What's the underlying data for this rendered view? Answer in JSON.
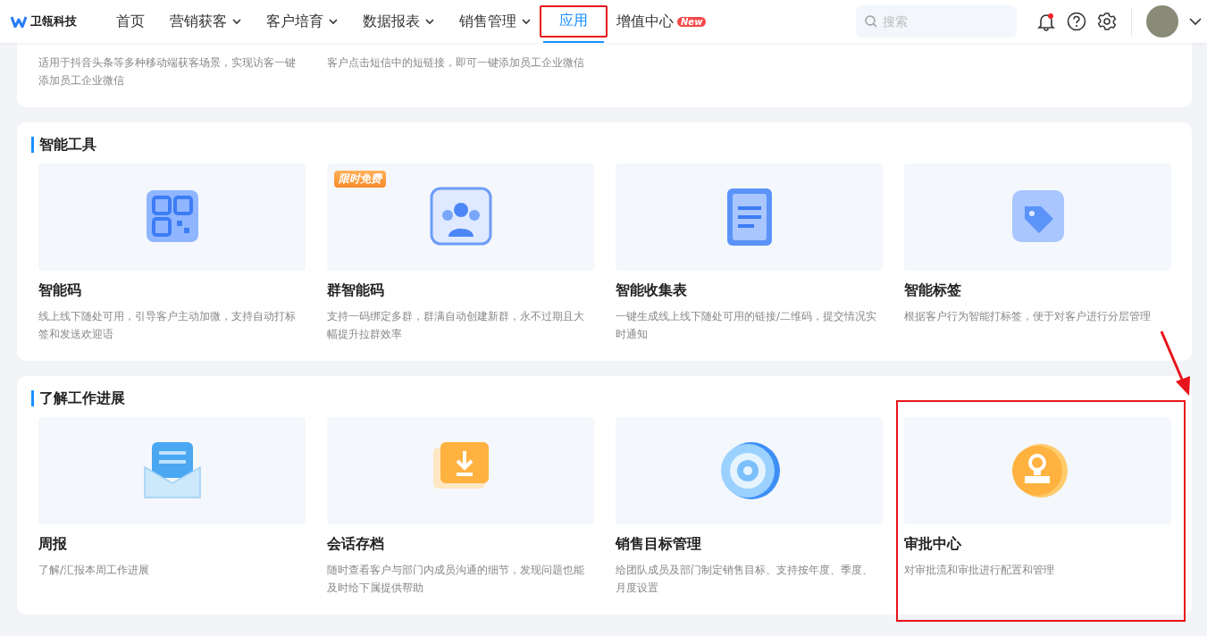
{
  "header": {
    "logo": "卫瓴科技",
    "nav": [
      {
        "label": "首页",
        "dropdown": false,
        "selected": false,
        "highlighted": false
      },
      {
        "label": "营销获客",
        "dropdown": true,
        "selected": false,
        "highlighted": false
      },
      {
        "label": "客户培育",
        "dropdown": true,
        "selected": false,
        "highlighted": false
      },
      {
        "label": "数据报表",
        "dropdown": true,
        "selected": false,
        "highlighted": false
      },
      {
        "label": "销售管理",
        "dropdown": true,
        "selected": false,
        "highlighted": false
      },
      {
        "label": "应用",
        "dropdown": false,
        "selected": true,
        "highlighted": true
      },
      {
        "label": "增值中心",
        "dropdown": false,
        "selected": false,
        "highlighted": false,
        "badge": "New"
      }
    ],
    "search": {
      "placeholder": "搜索"
    },
    "notification_dot": true
  },
  "top_section": {
    "descriptions": [
      "适用于抖音头条等多种移动端获客场景，实现访客一键添加员工企业微信",
      "客户点击短信中的短链接，即可一键添加员工企业微信"
    ]
  },
  "sections": [
    {
      "title": "智能工具",
      "tiles": [
        {
          "kind": "qr",
          "name": "智能码",
          "description": "线上线下随处可用，引导客户主动加微，支持自动打标签和发送欢迎语",
          "highlighted": false
        },
        {
          "kind": "group",
          "name": "群智能码",
          "description": "支持一码绑定多群，群满自动创建新群，永不过期且大幅提升拉群效率",
          "badge": "限时免费",
          "highlighted": false
        },
        {
          "kind": "form",
          "name": "智能收集表",
          "description": "一键生成线上线下随处可用的链接/二维码，提交情况实时通知",
          "highlighted": false
        },
        {
          "kind": "tag",
          "name": "智能标签",
          "description": "根据客户行为智能打标签，便于对客户进行分层管理",
          "highlighted": false
        }
      ]
    },
    {
      "title": "了解工作进展",
      "tiles": [
        {
          "kind": "report",
          "name": "周报",
          "description": "了解/汇报本周工作进展",
          "highlighted": false
        },
        {
          "kind": "chat",
          "name": "会话存档",
          "description": "随时查看客户与部门内成员沟通的细节，发现问题也能及时给下属提供帮助",
          "highlighted": false
        },
        {
          "kind": "target",
          "name": "销售目标管理",
          "description": "给团队成员及部门制定销售目标、支持按年度、季度、月度设置",
          "highlighted": false
        },
        {
          "kind": "stamp",
          "name": "审批中心",
          "description": "对审批流和审批进行配置和管理",
          "highlighted": true
        }
      ]
    }
  ]
}
